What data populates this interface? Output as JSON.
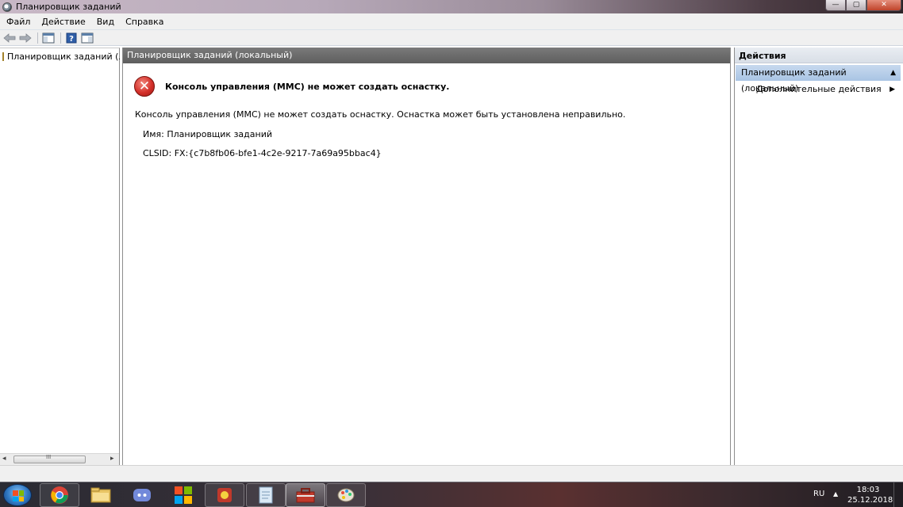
{
  "window": {
    "title": "Планировщик заданий",
    "controls": {
      "minimize": "—",
      "maximize": "▢",
      "close": "✕"
    }
  },
  "menu": {
    "items": [
      "Файл",
      "Действие",
      "Вид",
      "Справка"
    ]
  },
  "toolbar": {
    "icons": [
      "back-arrow-icon",
      "forward-arrow-icon",
      "show-hide-console-tree-icon",
      "help-icon",
      "show-hide-action-pane-icon"
    ]
  },
  "tree": {
    "root_label": "Планировщик заданий (локальный)"
  },
  "center": {
    "header": "Планировщик заданий (локальный)",
    "error_title": "Консоль управления (MMC) не может создать оснастку.",
    "error_description": "Консоль управления (MMC) не может создать оснастку. Оснастка может быть установлена неправильно.",
    "name_line": "Имя: Планировщик заданий",
    "clsid_line": "CLSID: FX:{c7b8fb06-bfe1-4c2e-9217-7a69a95bbac4}"
  },
  "actions": {
    "header": "Действия",
    "group_label": "Планировщик заданий (локальный)",
    "sub_item": "Дополнительные действия"
  },
  "taskbar": {
    "apps": [
      "chrome",
      "file-explorer",
      "discord",
      "windows-logo-app",
      "red-app",
      "notepad-app",
      "toolbox-app",
      "paint-app"
    ],
    "tray_language": "RU",
    "tray_arrow": "▲",
    "clock_time": "18:03",
    "clock_date": "25.12.2018"
  },
  "colors": {
    "center_header_bg": "#6b6b6b",
    "actions_group_bg": "#b8cfea",
    "error_red": "#d4302a"
  }
}
